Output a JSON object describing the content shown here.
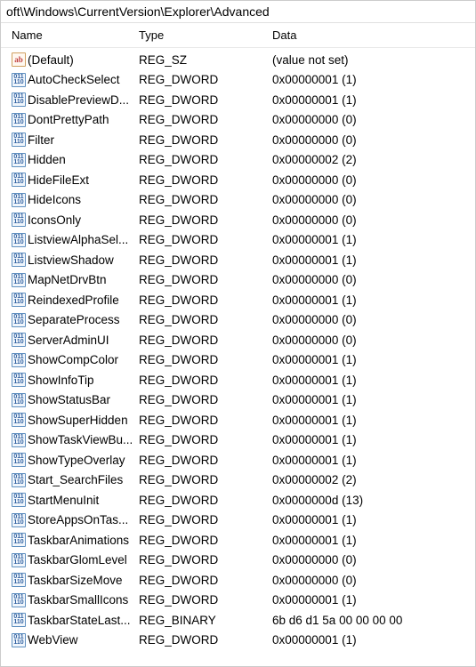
{
  "path": "oft\\Windows\\CurrentVersion\\Explorer\\Advanced",
  "columns": {
    "name": "Name",
    "type": "Type",
    "data": "Data"
  },
  "entries": [
    {
      "icon": "sz",
      "name": "(Default)",
      "type": "REG_SZ",
      "data": "(value not set)"
    },
    {
      "icon": "dword",
      "name": "AutoCheckSelect",
      "type": "REG_DWORD",
      "data": "0x00000001 (1)"
    },
    {
      "icon": "dword",
      "name": "DisablePreviewD...",
      "type": "REG_DWORD",
      "data": "0x00000001 (1)"
    },
    {
      "icon": "dword",
      "name": "DontPrettyPath",
      "type": "REG_DWORD",
      "data": "0x00000000 (0)"
    },
    {
      "icon": "dword",
      "name": "Filter",
      "type": "REG_DWORD",
      "data": "0x00000000 (0)"
    },
    {
      "icon": "dword",
      "name": "Hidden",
      "type": "REG_DWORD",
      "data": "0x00000002 (2)"
    },
    {
      "icon": "dword",
      "name": "HideFileExt",
      "type": "REG_DWORD",
      "data": "0x00000000 (0)"
    },
    {
      "icon": "dword",
      "name": "HideIcons",
      "type": "REG_DWORD",
      "data": "0x00000000 (0)"
    },
    {
      "icon": "dword",
      "name": "IconsOnly",
      "type": "REG_DWORD",
      "data": "0x00000000 (0)"
    },
    {
      "icon": "dword",
      "name": "ListviewAlphaSel...",
      "type": "REG_DWORD",
      "data": "0x00000001 (1)"
    },
    {
      "icon": "dword",
      "name": "ListviewShadow",
      "type": "REG_DWORD",
      "data": "0x00000001 (1)"
    },
    {
      "icon": "dword",
      "name": "MapNetDrvBtn",
      "type": "REG_DWORD",
      "data": "0x00000000 (0)"
    },
    {
      "icon": "dword",
      "name": "ReindexedProfile",
      "type": "REG_DWORD",
      "data": "0x00000001 (1)"
    },
    {
      "icon": "dword",
      "name": "SeparateProcess",
      "type": "REG_DWORD",
      "data": "0x00000000 (0)"
    },
    {
      "icon": "dword",
      "name": "ServerAdminUI",
      "type": "REG_DWORD",
      "data": "0x00000000 (0)"
    },
    {
      "icon": "dword",
      "name": "ShowCompColor",
      "type": "REG_DWORD",
      "data": "0x00000001 (1)"
    },
    {
      "icon": "dword",
      "name": "ShowInfoTip",
      "type": "REG_DWORD",
      "data": "0x00000001 (1)"
    },
    {
      "icon": "dword",
      "name": "ShowStatusBar",
      "type": "REG_DWORD",
      "data": "0x00000001 (1)"
    },
    {
      "icon": "dword",
      "name": "ShowSuperHidden",
      "type": "REG_DWORD",
      "data": "0x00000001 (1)"
    },
    {
      "icon": "dword",
      "name": "ShowTaskViewBu...",
      "type": "REG_DWORD",
      "data": "0x00000001 (1)"
    },
    {
      "icon": "dword",
      "name": "ShowTypeOverlay",
      "type": "REG_DWORD",
      "data": "0x00000001 (1)"
    },
    {
      "icon": "dword",
      "name": "Start_SearchFiles",
      "type": "REG_DWORD",
      "data": "0x00000002 (2)"
    },
    {
      "icon": "dword",
      "name": "StartMenuInit",
      "type": "REG_DWORD",
      "data": "0x0000000d (13)"
    },
    {
      "icon": "dword",
      "name": "StoreAppsOnTas...",
      "type": "REG_DWORD",
      "data": "0x00000001 (1)"
    },
    {
      "icon": "dword",
      "name": "TaskbarAnimations",
      "type": "REG_DWORD",
      "data": "0x00000001 (1)"
    },
    {
      "icon": "dword",
      "name": "TaskbarGlomLevel",
      "type": "REG_DWORD",
      "data": "0x00000000 (0)"
    },
    {
      "icon": "dword",
      "name": "TaskbarSizeMove",
      "type": "REG_DWORD",
      "data": "0x00000000 (0)"
    },
    {
      "icon": "dword",
      "name": "TaskbarSmallIcons",
      "type": "REG_DWORD",
      "data": "0x00000001 (1)"
    },
    {
      "icon": "dword",
      "name": "TaskbarStateLast...",
      "type": "REG_BINARY",
      "data": "6b d6 d1 5a 00 00 00 00"
    },
    {
      "icon": "dword",
      "name": "WebView",
      "type": "REG_DWORD",
      "data": "0x00000001 (1)"
    }
  ]
}
